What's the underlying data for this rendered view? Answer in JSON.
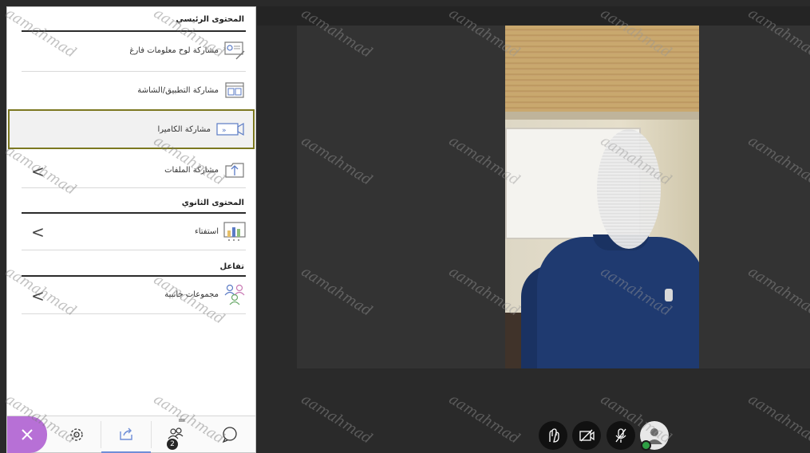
{
  "panel": {
    "sections": {
      "primary": "المحتوى الرئيسي",
      "secondary": "المحتوى الثانوي",
      "interaction": "تفاعل"
    },
    "items": {
      "whiteboard": "مشاركة لوح معلومات فارغ",
      "application": "مشاركة التطبيق/الشاشة",
      "camera": "مشاركة الكاميرا",
      "files": "مشاركة الملفات",
      "poll": "استفتاء",
      "breakout": "مجموعات جانبية"
    },
    "chevron": "<",
    "toolbar": {
      "attendees_count": "2"
    }
  },
  "watermark": "aamahmad",
  "colors": {
    "close_button": "#b770d6",
    "highlight_border": "#7c7820",
    "status_green": "#2e9f44",
    "stage_bg": "#2a2a2a"
  },
  "icons": [
    "whiteboard-icon",
    "screen-share-icon",
    "camera-share-icon",
    "file-share-icon",
    "poll-icon",
    "breakout-groups-icon",
    "close-icon",
    "gear-icon",
    "share-icon",
    "attendees-icon",
    "chat-icon",
    "raise-hand-icon",
    "camera-off-icon",
    "mic-off-icon",
    "profile-icon"
  ]
}
